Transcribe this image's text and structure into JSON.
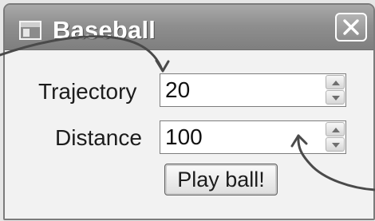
{
  "window": {
    "title": "Baseball",
    "icon": "window-app-icon",
    "close_icon": "close-icon"
  },
  "fields": [
    {
      "label": "Trajectory",
      "value": "20"
    },
    {
      "label": "Distance",
      "value": "100"
    }
  ],
  "actions": {
    "play_label": "Play ball!"
  },
  "icons": {
    "spin_up": "chevron-up-icon",
    "spin_down": "chevron-down-icon"
  }
}
